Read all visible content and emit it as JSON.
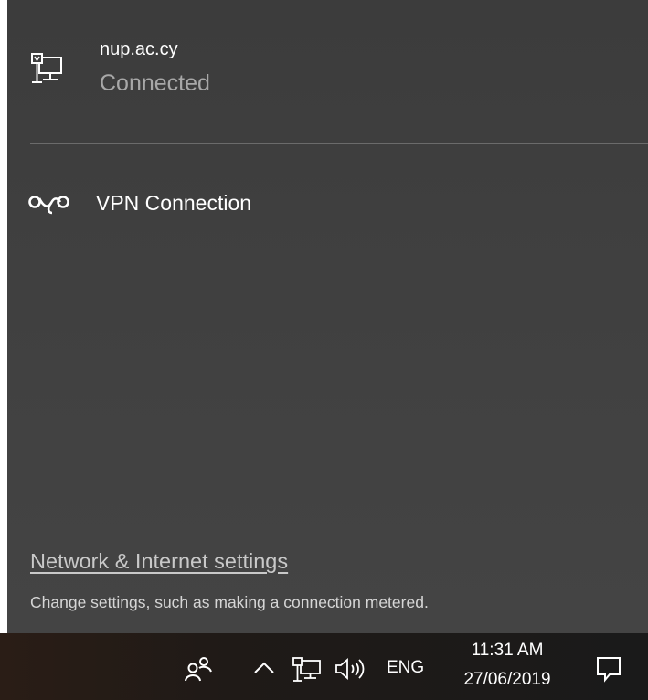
{
  "flyout": {
    "network": {
      "name": "nup.ac.cy",
      "status": "Connected",
      "icon": "ethernet-network-icon"
    },
    "vpn": {
      "label": "VPN Connection",
      "icon": "vpn-icon"
    },
    "settings": {
      "link_label": "Network & Internet settings",
      "description": "Change settings, such as making a connection metered."
    },
    "colors": {
      "background": "#404040",
      "status_text": "#a8a8a8",
      "divider": "#6b6b6b"
    }
  },
  "taskbar": {
    "people_icon": "people-icon",
    "overflow_icon": "chevron-up-icon",
    "network_icon": "network-icon",
    "volume_icon": "speaker-volume-icon",
    "language": "ENG",
    "time": "11:31 AM",
    "date": "27/06/2019",
    "action_center_icon": "action-center-icon"
  }
}
